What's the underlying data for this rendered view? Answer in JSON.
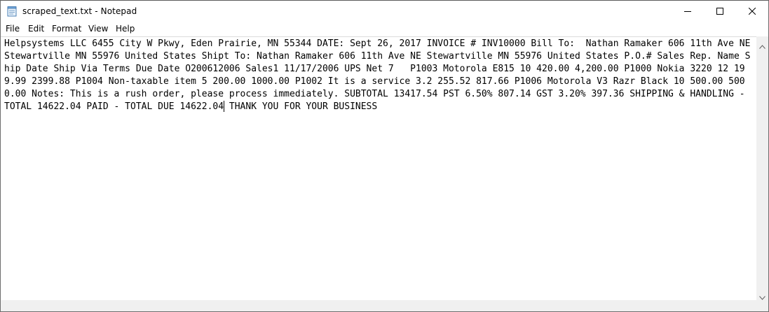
{
  "window": {
    "title": "scraped_text.txt - Notepad"
  },
  "icons": {
    "app": "notepad-icon",
    "minimize": "minimize-icon",
    "maximize": "maximize-icon",
    "close": "close-icon",
    "scroll_up": "chevron-up-icon",
    "scroll_down": "chevron-down-icon"
  },
  "menu": [
    {
      "label": "File"
    },
    {
      "label": "Edit"
    },
    {
      "label": "Format"
    },
    {
      "label": "View"
    },
    {
      "label": "Help"
    }
  ],
  "editor": {
    "text": "Helpsystems LLC 6455 City W Pkwy, Eden Prairie, MN 55344 DATE: Sept 26, 2017 INVOICE # INV10000 Bill To:  Nathan Ramaker 606 11th Ave NE Stewartville MN 55976 United States Shipt To: Nathan Ramaker 606 11th Ave NE Stewartville MN 55976 United States P.O.# Sales Rep. Name Ship Date Ship Via Terms Due Date O200612006 Sales1 11/17/2006 UPS Net 7   P1003 Motorola E815 10 420.00 4,200.00 P1000 Nokia 3220 12 199.99 2399.88 P1004 Non-taxable item 5 200.00 1000.00 P1002 It is a service 3.2 255.52 817.66 P1006 Motorola V3 Razr Black 10 500.00 5000.00 Notes: This is a rush order, please process immediately. SUBTOTAL 13417.54 PST 6.50% 807.14 GST 3.20% 397.36 SHIPPING & HANDLING - TOTAL 14622.04 PAID - TOTAL DUE 14622.04 THANK YOU FOR YOUR BUSINESS"
  }
}
